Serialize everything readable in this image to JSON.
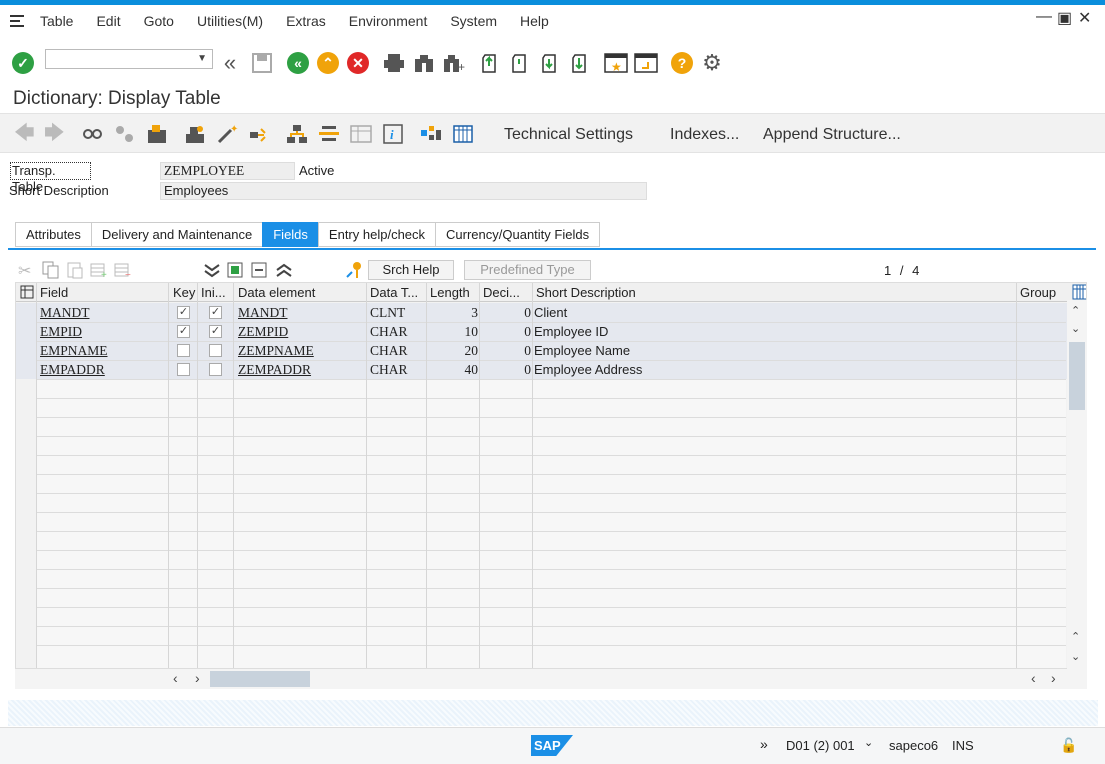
{
  "menubar": {
    "items": [
      "Table",
      "Edit",
      "Goto",
      "Utilities(M)",
      "Extras",
      "Environment",
      "System",
      "Help"
    ]
  },
  "page": {
    "title": "Dictionary: Display Table"
  },
  "toolbar2": {
    "technical_settings": "Technical Settings",
    "indexes": "Indexes...",
    "append_structure": "Append Structure..."
  },
  "header": {
    "transp_table_label": "Transp. Table",
    "table_name": "ZEMPLOYEE",
    "status": "Active",
    "short_desc_label": "Short Description",
    "short_desc": "Employees"
  },
  "tabs": [
    "Attributes",
    "Delivery and Maintenance",
    "Fields",
    "Entry help/check",
    "Currency/Quantity Fields"
  ],
  "grid_toolbar": {
    "srch_help": "Srch Help",
    "predefined_type": "Predefined Type",
    "page_current": "1",
    "page_sep": "/",
    "page_total": "4"
  },
  "columns": {
    "field": "Field",
    "key": "Key",
    "ini": "Ini...",
    "data_element": "Data element",
    "data_type": "Data T...",
    "length": "Length",
    "deci": "Deci...",
    "short_description": "Short Description",
    "group": "Group"
  },
  "rows": [
    {
      "field": "MANDT",
      "key": true,
      "ini": true,
      "data_element": "MANDT",
      "data_type": "CLNT",
      "length": "3",
      "deci": "0",
      "desc": "Client"
    },
    {
      "field": "EMPID",
      "key": true,
      "ini": true,
      "data_element": "ZEMPID",
      "data_type": "CHAR",
      "length": "10",
      "deci": "0",
      "desc": "Employee ID"
    },
    {
      "field": "EMPNAME",
      "key": false,
      "ini": false,
      "data_element": "ZEMPNAME",
      "data_type": "CHAR",
      "length": "20",
      "deci": "0",
      "desc": "Employee Name"
    },
    {
      "field": "EMPADDR",
      "key": false,
      "ini": false,
      "data_element": "ZEMPADDR",
      "data_type": "CHAR",
      "length": "40",
      "deci": "0",
      "desc": "Employee Address"
    }
  ],
  "statusbar": {
    "logo": "SAP",
    "system": "D01 (2) 001",
    "user": "sapeco6",
    "mode": "INS"
  },
  "colors": {
    "accent": "#1b8fe6",
    "green": "#2ea043",
    "orange": "#f0a30a",
    "red": "#e02828"
  }
}
